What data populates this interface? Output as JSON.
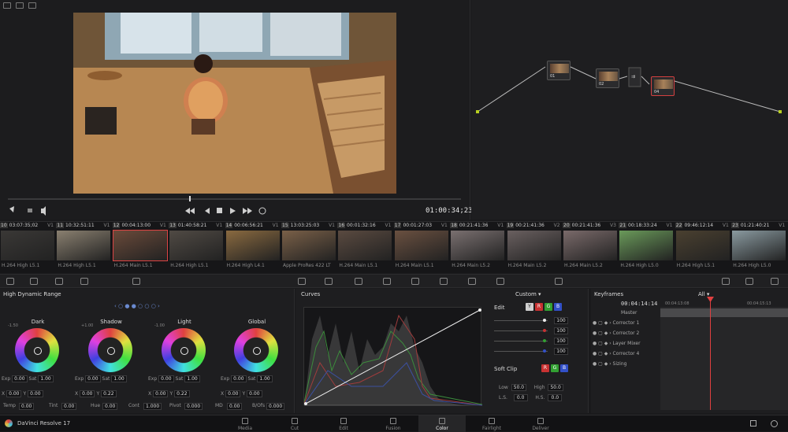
{
  "viewer": {
    "timecode": "01:00:34;23",
    "playhead_fraction": 0.4
  },
  "nodes": [
    {
      "label": "01"
    },
    {
      "label": "02"
    },
    {
      "label": "04"
    }
  ],
  "clips": [
    {
      "num": "10",
      "tc": "03:07:35;02",
      "track": "V1",
      "codec": "H.264 High L5.1"
    },
    {
      "num": "11",
      "tc": "10:32:51:11",
      "track": "V1",
      "codec": "H.264 High L5.1"
    },
    {
      "num": "12",
      "tc": "00:04:13:00",
      "track": "V1",
      "codec": "H.264 Main L5.1"
    },
    {
      "num": "13",
      "tc": "01:40:58:21",
      "track": "V1",
      "codec": "H.264 High L5.1"
    },
    {
      "num": "14",
      "tc": "00:06:56:21",
      "track": "V1",
      "codec": "H.264 High L4.1"
    },
    {
      "num": "15",
      "tc": "13:03:25:03",
      "track": "V1",
      "codec": "Apple ProRes 422 LT"
    },
    {
      "num": "16",
      "tc": "00:01:32:16",
      "track": "V1",
      "codec": "H.264 Main L5.1"
    },
    {
      "num": "17",
      "tc": "00:01:27:03",
      "track": "V1",
      "codec": "H.264 Main L5.1"
    },
    {
      "num": "18",
      "tc": "00:21:41:36",
      "track": "V1",
      "codec": "H.264 Main L5.2"
    },
    {
      "num": "19",
      "tc": "00:21:41:36",
      "track": "V2",
      "codec": "H.264 Main L5.2"
    },
    {
      "num": "20",
      "tc": "00:21:41:36",
      "track": "V3",
      "codec": "H.264 Main L5.2"
    },
    {
      "num": "21",
      "tc": "00:18:33:24",
      "track": "V1",
      "codec": "H.264 High L5.0"
    },
    {
      "num": "22",
      "tc": "09:46:12:14",
      "track": "V1",
      "codec": "H.264 High L5.1"
    },
    {
      "num": "23",
      "tc": "01:21:40:21",
      "track": "V1",
      "codec": "H.264 High L5.0"
    }
  ],
  "wheels_panel": {
    "title": "High Dynamic Range",
    "wheels": [
      {
        "name": "Dark",
        "zone": "-1.50",
        "exp": "0.00",
        "sat": "1.00",
        "x": "0.00",
        "y": "0.00"
      },
      {
        "name": "Shadow",
        "zone": "+1.00",
        "exp": "0.00",
        "sat": "1.00",
        "x": "0.00",
        "y": "0.22"
      },
      {
        "name": "Light",
        "zone": "-1.00",
        "exp": "0.00",
        "sat": "1.00",
        "x": "0.00",
        "y": "0.22"
      },
      {
        "name": "Global",
        "zone": "",
        "exp": "0.00",
        "sat": "1.00",
        "x": "0.00",
        "y": "0.00"
      }
    ],
    "labels": {
      "exp": "Exp",
      "sat": "Sat",
      "x": "X",
      "y": "Y"
    },
    "bottom": [
      {
        "label": "Temp",
        "value": "0.00"
      },
      {
        "label": "Tint",
        "value": "0.00"
      },
      {
        "label": "Hue",
        "value": "0.00"
      },
      {
        "label": "Cont",
        "value": "1.000"
      },
      {
        "label": "Pivot",
        "value": "0.000"
      },
      {
        "label": "MD",
        "value": "0.00"
      },
      {
        "label": "B/Ofs",
        "value": "0.000"
      }
    ]
  },
  "curves_panel": {
    "title": "Curves",
    "mode": "Custom",
    "edit_label": "Edit",
    "channel_values": [
      "100",
      "100",
      "100",
      "100"
    ],
    "soft_clip_label": "Soft Clip",
    "low_label": "Low",
    "low_value": "50.0",
    "high_label": "High",
    "high_value": "50.0",
    "ls_label": "L.S.",
    "ls_value": "0.0",
    "hs_label": "H.S.",
    "hs_value": "0.0",
    "channel_letters": [
      "Y",
      "R",
      "G",
      "B"
    ]
  },
  "keyframes_panel": {
    "title": "Keyframes",
    "filter": "All",
    "timecode": "00:04:14:14",
    "ruler_start": "00:04:13:08",
    "ruler_end": "00:04:15:13",
    "rows": [
      "Master",
      "Corrector 1",
      "Corrector 2",
      "Layer Mixer",
      "Corrector 4",
      "Sizing"
    ]
  },
  "pagebar": {
    "app_name": "DaVinci Resolve 17",
    "pages": [
      "Media",
      "Cut",
      "Edit",
      "Fusion",
      "Color",
      "Fairlight",
      "Deliver"
    ],
    "active": "Color"
  },
  "colors": {
    "accent_red": "#d44040",
    "channel_r": "#c83232",
    "channel_g": "#32a032",
    "channel_b": "#3250c8"
  }
}
